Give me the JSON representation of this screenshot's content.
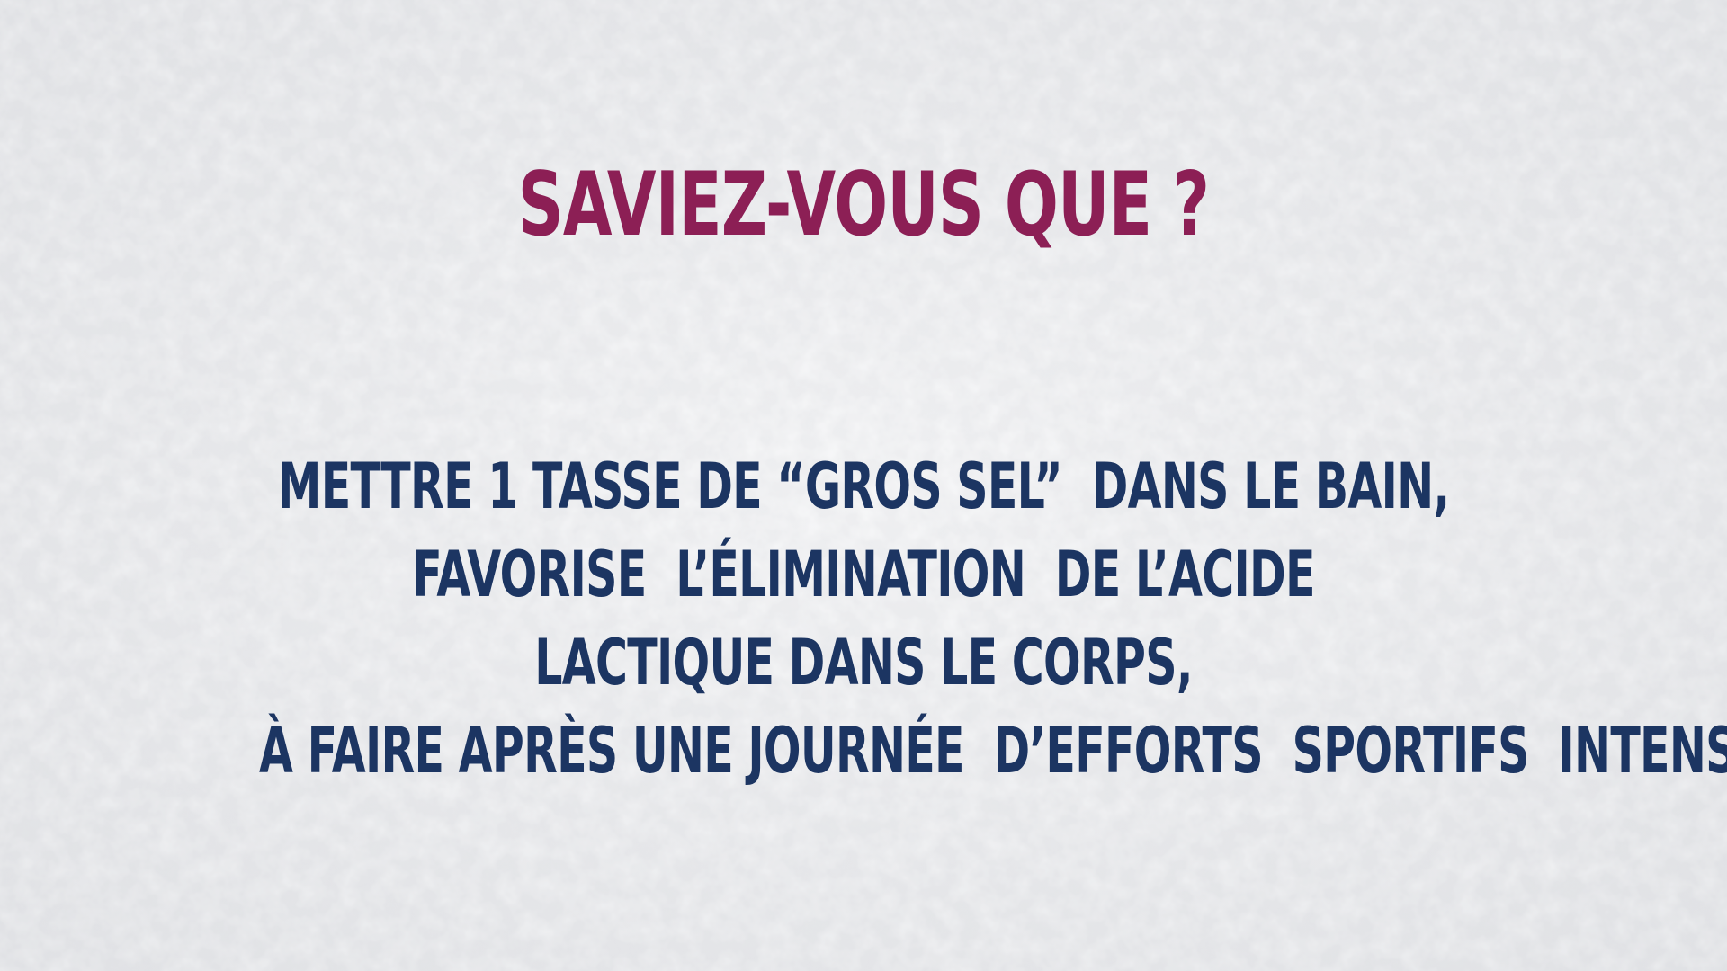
{
  "slide": {
    "title": "SAVIEZ-VOUS QUE ?",
    "lines": [
      "METTRE 1 TASSE DE “GROS SEL”  DANS LE BAIN,",
      "FAVORISE  L’ÉLIMINATION  DE L’ACIDE",
      "LACTIQUE DANS LE CORPS,",
      "À FAIRE APRÈS UNE JOURNÉE  D’EFFORTS  SPORTIFS  INTENSES  ..."
    ]
  },
  "colors": {
    "title": "#8c1f55",
    "body": "#1c3562",
    "background": "#e9eaec"
  }
}
